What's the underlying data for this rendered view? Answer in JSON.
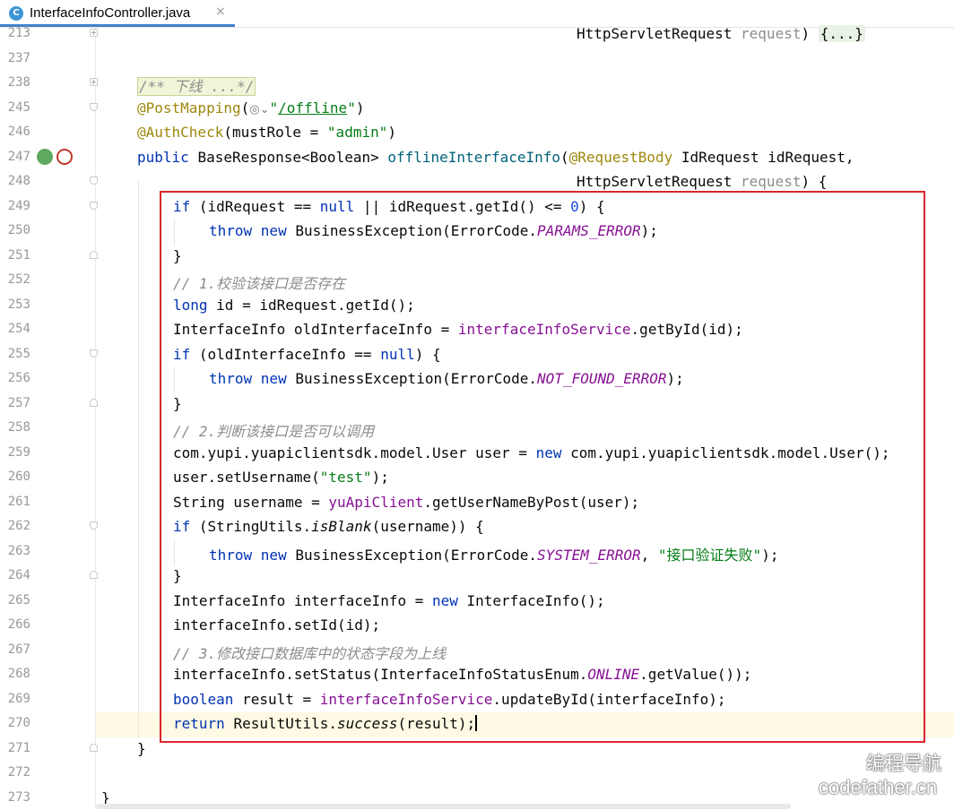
{
  "tab": {
    "title": "InterfaceInfoController.java",
    "icon": "C",
    "close": "×"
  },
  "line_numbers": [
    "213",
    "237",
    "238",
    "245",
    "246",
    "247",
    "248",
    "249",
    "250",
    "251",
    "252",
    "253",
    "254",
    "255",
    "256",
    "257",
    "258",
    "259",
    "260",
    "261",
    "262",
    "263",
    "264",
    "265",
    "266",
    "267",
    "268",
    "269",
    "270",
    "271",
    "272",
    "273"
  ],
  "code": {
    "l213": {
      "a": "HttpServletRequest ",
      "b": "request",
      "c": ") ",
      "d": "{...}"
    },
    "l238": {
      "a": "/** 下线 ...*/"
    },
    "l245": {
      "ann": "@PostMapping",
      "open": "(",
      "q1": "\"",
      "path": "/offline",
      "q2": "\"",
      "close": ")"
    },
    "l246": {
      "ann": "@AuthCheck",
      "rest": "(mustRole = ",
      "str": "\"admin\"",
      "close": ")"
    },
    "l247": {
      "kw": "public ",
      "type": "BaseResponse<Boolean> ",
      "meth": "offlineInterfaceInfo",
      "open": "(",
      "ann": "@RequestBody",
      "rest": " IdRequest idRequest,"
    },
    "l248": {
      "a": "HttpServletRequest ",
      "b": "request",
      "c": ") {"
    },
    "l249": {
      "kw": "if",
      "a": " (idRequest == ",
      "null1": "null",
      "b": " || idRequest.getId() <= ",
      "num": "0",
      "c": ") {"
    },
    "l250": {
      "kw1": "throw ",
      "kw2": "new ",
      "a": "BusinessException(ErrorCode.",
      "f": "PARAMS_ERROR",
      "b": ");"
    },
    "l251": {
      "a": "}"
    },
    "l252": {
      "cmt": "// 1.校验该接口是否存在"
    },
    "l253": {
      "kw": "long ",
      "a": "id = idRequest.getId();"
    },
    "l254": {
      "a": "InterfaceInfo oldInterfaceInfo = ",
      "f": "interfaceInfoService",
      "b": ".getById(id);"
    },
    "l255": {
      "kw": "if",
      "a": " (oldInterfaceInfo == ",
      "null1": "null",
      "b": ") {"
    },
    "l256": {
      "kw1": "throw ",
      "kw2": "new ",
      "a": "BusinessException(ErrorCode.",
      "f": "NOT_FOUND_ERROR",
      "b": ");"
    },
    "l257": {
      "a": "}"
    },
    "l258": {
      "cmt": "// 2.判断该接口是否可以调用"
    },
    "l259": {
      "a": "com.yupi.yuapiclientsdk.model.User user = ",
      "kw": "new ",
      "b": "com.yupi.yuapiclientsdk.model.User();"
    },
    "l260": {
      "a": "user.setUsername(",
      "str": "\"test\"",
      "b": ");"
    },
    "l261": {
      "a": "String username = ",
      "f": "yuApiClient",
      "b": ".getUserNameByPost(user);"
    },
    "l262": {
      "kw": "if",
      "a": " (StringUtils.",
      "it": "isBlank",
      "b": "(username)) {"
    },
    "l263": {
      "kw1": "throw ",
      "kw2": "new ",
      "a": "BusinessException(ErrorCode.",
      "f": "SYSTEM_ERROR",
      "b": ", ",
      "str": "\"接口验证失败\"",
      "c": ");"
    },
    "l264": {
      "a": "}"
    },
    "l265": {
      "a": "InterfaceInfo interfaceInfo = ",
      "kw": "new ",
      "b": "InterfaceInfo();"
    },
    "l266": {
      "a": "interfaceInfo.setId(id);"
    },
    "l267": {
      "cmt": "// 3.修改接口数据库中的状态字段为上线"
    },
    "l268": {
      "a": "interfaceInfo.setStatus(InterfaceInfoStatusEnum.",
      "f": "ONLINE",
      "b": ".getValue());"
    },
    "l269": {
      "kw": "boolean ",
      "a": "result = ",
      "f": "interfaceInfoService",
      "b": ".updateById(interfaceInfo);"
    },
    "l270": {
      "kw": "return ",
      "a": "ResultUtils.",
      "it": "success",
      "b": "(result);"
    },
    "l271": {
      "a": "}"
    },
    "l273": {
      "a": "}"
    }
  },
  "watermark": {
    "line1": "编程导航",
    "line2": "codefather.cn"
  },
  "colors": {
    "keyword": "#0033b3",
    "string": "#067d17",
    "comment": "#8c8c8c",
    "field": "#871094",
    "annotation": "#9e880d",
    "highlight_box": "#d9262b",
    "tab_accent": "#4083c9"
  }
}
